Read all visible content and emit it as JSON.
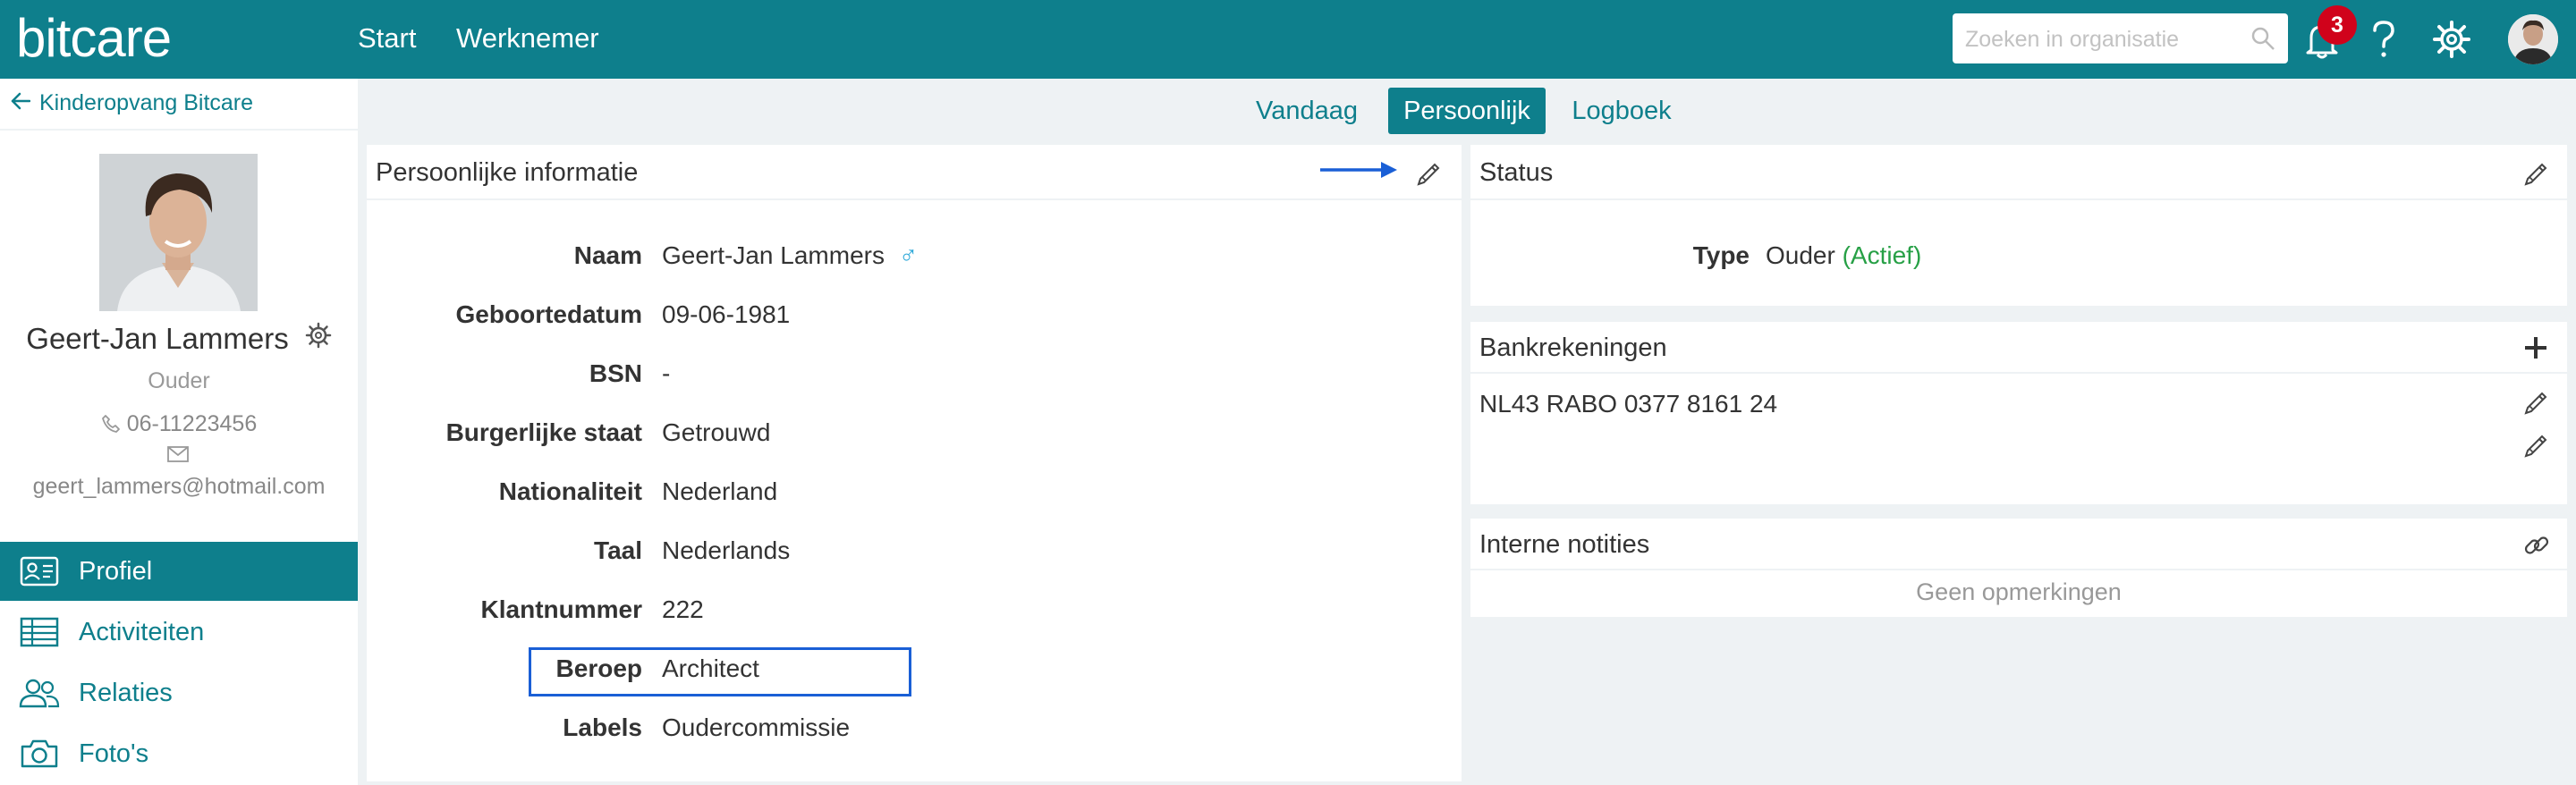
{
  "header": {
    "logo": "bitcare",
    "nav": [
      "Start",
      "Werknemer"
    ],
    "search_placeholder": "Zoeken in organisatie",
    "notification_count": "3"
  },
  "sidebar": {
    "back_label": "Kinderopvang Bitcare",
    "profile": {
      "name": "Geert-Jan Lammers",
      "role": "Ouder",
      "phone": "06-11223456",
      "email": "geert_lammers@hotmail.com"
    },
    "menu": [
      {
        "label": "Profiel",
        "icon": "id-card-icon",
        "active": true
      },
      {
        "label": "Activiteiten",
        "icon": "table-icon",
        "active": false
      },
      {
        "label": "Relaties",
        "icon": "users-icon",
        "active": false
      },
      {
        "label": "Foto's",
        "icon": "camera-icon",
        "active": false
      }
    ]
  },
  "tabs": [
    {
      "label": "Vandaag",
      "active": false
    },
    {
      "label": "Persoonlijk",
      "active": true
    },
    {
      "label": "Logboek",
      "active": false
    }
  ],
  "personal": {
    "title": "Persoonlijke informatie",
    "gender_symbol": "♂",
    "fields": [
      {
        "label": "Naam",
        "value": "Geert-Jan Lammers"
      },
      {
        "label": "Geboortedatum",
        "value": "09-06-1981"
      },
      {
        "label": "BSN",
        "value": "-"
      },
      {
        "label": "Burgerlijke staat",
        "value": "Getrouwd"
      },
      {
        "label": "Nationaliteit",
        "value": "Nederland"
      },
      {
        "label": "Taal",
        "value": "Nederlands"
      },
      {
        "label": "Klantnummer",
        "value": "222"
      },
      {
        "label": "Beroep",
        "value": "Architect"
      },
      {
        "label": "Labels",
        "value": "Oudercommissie"
      }
    ]
  },
  "status": {
    "title": "Status",
    "type_label": "Type",
    "type_value": "Ouder",
    "type_state": "(Actief)"
  },
  "bank": {
    "title": "Bankrekeningen",
    "account": "NL43 RABO 0377 8161 24"
  },
  "notes": {
    "title": "Interne notities",
    "empty": "Geen opmerkingen"
  },
  "colors": {
    "brand": "#0e7f8c",
    "active_status": "#27a046",
    "badge": "#d0021b",
    "highlight": "#1a5fd6"
  }
}
